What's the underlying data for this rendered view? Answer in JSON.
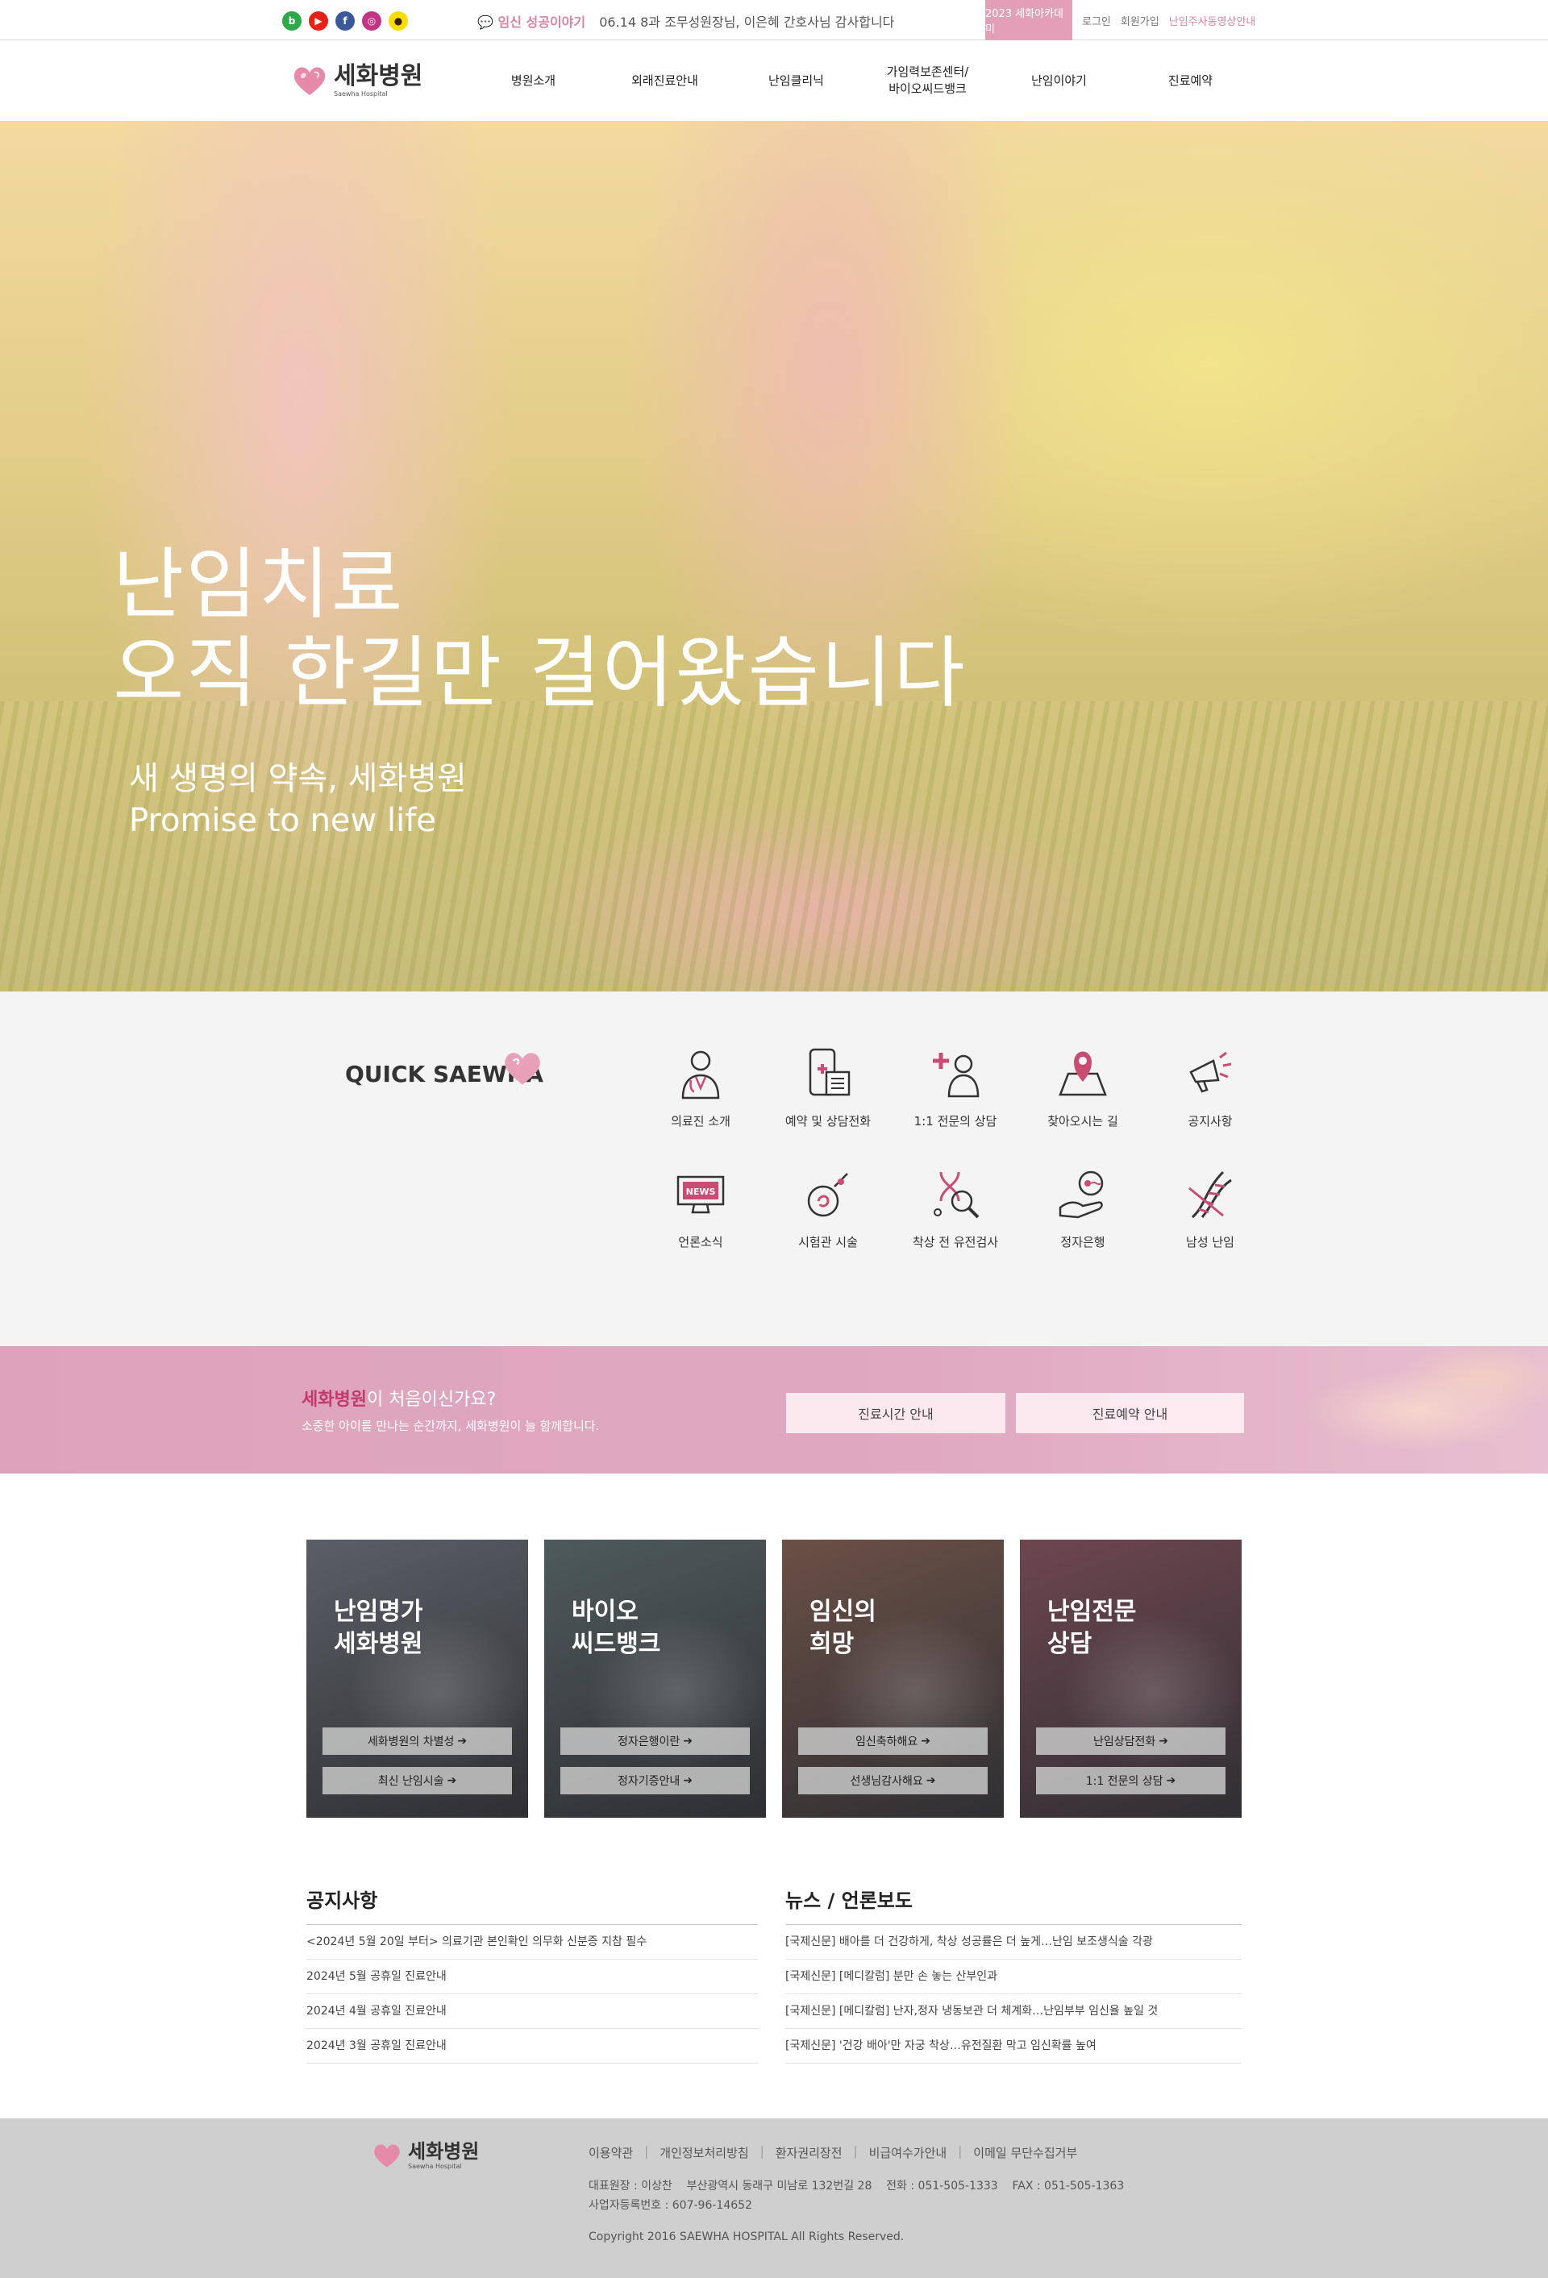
{
  "topbar": {
    "sns": [
      {
        "icon": "blog-icon",
        "glyph": "b",
        "color": "#2ea84a"
      },
      {
        "icon": "youtube-icon",
        "glyph": "▶",
        "color": "#e62117"
      },
      {
        "icon": "facebook-icon",
        "glyph": "f",
        "color": "#3b5998"
      },
      {
        "icon": "instagram-icon",
        "glyph": "◎",
        "color": "#c13584"
      },
      {
        "icon": "kakao-icon",
        "glyph": "●",
        "color": "#f9dd00"
      }
    ],
    "ticker_label": "임신 성공이야기",
    "ticker_text": "06.14 8과 조무성원장님, 이은혜 간호사님 감사합니다",
    "academy": "2023 세화아카데미",
    "login": "로그인",
    "join": "회원가입",
    "consult": "난임주사동영상안내"
  },
  "logo": {
    "ko": "세화병원",
    "en": "Saewha Hospital"
  },
  "menu": [
    "병원소개",
    "외래진료안내",
    "난임클리닉",
    "가임력보존센터/\n바이오씨드뱅크",
    "난임이야기",
    "진료예약"
  ],
  "hero": {
    "line1": "난임치료",
    "line2": "오직 한길만 걸어왔습니다",
    "sub1": "새 생명의 약속, 세화병원",
    "sub2": "Promise to new life"
  },
  "quick": {
    "title": "QUICK SAEWHA",
    "items": [
      {
        "label": "의료진 소개",
        "icon": "doctor-icon"
      },
      {
        "label": "예약 및 상담전화",
        "icon": "phone-calendar-icon"
      },
      {
        "label": "1:1 전문의 상담",
        "icon": "consult-icon"
      },
      {
        "label": "찾아오시는 길",
        "icon": "map-pin-icon"
      },
      {
        "label": "공지사항",
        "icon": "megaphone-icon"
      },
      {
        "label": "언론소식",
        "icon": "news-icon"
      },
      {
        "label": "시험관 시술",
        "icon": "ivf-icon"
      },
      {
        "label": "착상 전 유전검사",
        "icon": "dna-search-icon"
      },
      {
        "label": "정자은행",
        "icon": "sperm-bank-icon"
      },
      {
        "label": "남성 난임",
        "icon": "dna-icon"
      }
    ]
  },
  "band": {
    "title_highlight": "세화병원",
    "title_rest": "이 처음이신가요?",
    "subtitle": "소중한 아이를 만나는 순간까지, 세화병원이 늘 함께합니다.",
    "btn1": "진료시간 안내",
    "btn2": "진료예약 안내"
  },
  "cards": [
    {
      "title1": "난임명가",
      "title2": "세화병원",
      "btn1": "세화병원의 차별성",
      "btn2": "최신 난임시술",
      "bg": "#5a5f66"
    },
    {
      "title1": "바이오",
      "title2": "씨드뱅크",
      "btn1": "정자은행이란",
      "btn2": "정자기증안내",
      "bg": "#4e5a5c"
    },
    {
      "title1": "임신의",
      "title2": "희망",
      "btn1": "임신축하해요",
      "btn2": "선생님감사해요",
      "bg": "#6b5046"
    },
    {
      "title1": "난임전문",
      "title2": "상담",
      "btn1": "난임상담전화",
      "btn2": "1:1 전문의 상담",
      "bg": "#6e4650"
    }
  ],
  "notice": {
    "title": "공지사항",
    "items": [
      "<2024년 5월 20일 부터> 의료기관 본인확인 의무화 신분증 지참 필수",
      "2024년 5월 공휴일 진료안내",
      "2024년 4월 공휴일 진료안내",
      "2024년 3월 공휴일 진료안내"
    ]
  },
  "news": {
    "title": "뉴스 / 언론보도",
    "items": [
      "[국제신문] 배아를 더 건강하게, 착상 성공률은 더 높게…난임 보조생식술 각광",
      "[국제신문] [메디칼럼] 분만 손 놓는 산부인과",
      "[국제신문] [메디칼럼] 난자,정자 냉동보관 더 체계화…난임부부 임신율 높일 것",
      "[국제신문] '건강 배아'만 자궁 착상…유전질환 막고 임신확률 높여"
    ]
  },
  "footer": {
    "links": [
      "이용약관",
      "개인정보처리방침",
      "환자권리장전",
      "비급여수가안내",
      "이메일 무단수집거부"
    ],
    "info1": "대표원장 : 이상찬    부산광역시 동래구 미남로 132번길 28    전화 : 051-505-1333    FAX : 051-505-1363",
    "info2": "사업자등록번호 : 607-96-14652",
    "copyright": "Copyright 2016 SAEWHA HOSPITAL All Rights Reserved."
  },
  "colors": {
    "accent": "#d5879f",
    "band": "#dda3bb",
    "highlight": "#c33a6e",
    "icon_pink": "#c94d72",
    "footer": "#cfcfcf"
  }
}
